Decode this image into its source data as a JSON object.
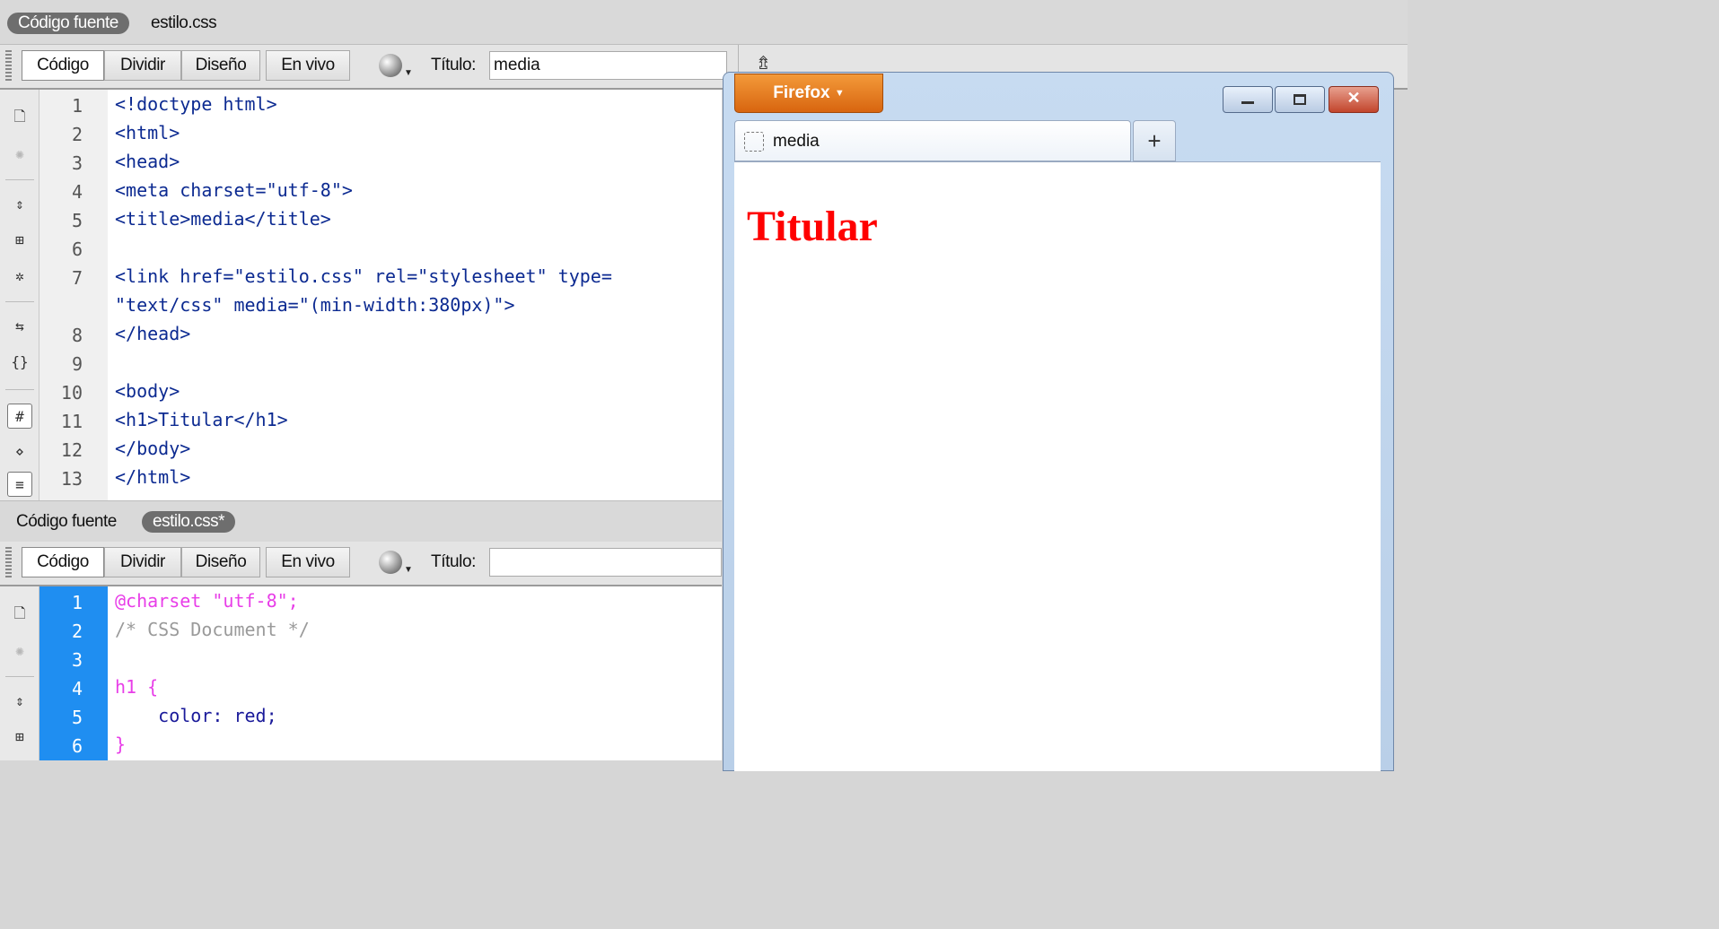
{
  "top_editor": {
    "files": {
      "source": "Código fuente",
      "related": "estilo.css"
    },
    "toolbar": {
      "buttons": [
        "Código",
        "Dividir",
        "Diseño",
        "En vivo"
      ],
      "title_label": "Título:",
      "title_value": "media"
    },
    "line_numbers": [
      "1",
      "2",
      "3",
      "4",
      "5",
      "6",
      "7",
      "",
      "8",
      "9",
      "10",
      "11",
      "12",
      "13"
    ],
    "code_lines": [
      "<!doctype html>",
      "<html>",
      "<head>",
      "<meta charset=\"utf-8\">",
      "<title>media</title>",
      "",
      "<link href=\"estilo.css\" rel=\"stylesheet\" type=",
      "\"text/css\" media=\"(min-width:380px)\">",
      "</head>",
      "",
      "<body>",
      "<h1>Titular</h1>",
      "</body>",
      "</html>"
    ]
  },
  "bottom_editor": {
    "files": {
      "source": "Código fuente",
      "related": "estilo.css*"
    },
    "toolbar": {
      "buttons": [
        "Código",
        "Dividir",
        "Diseño",
        "En vivo"
      ],
      "title_label": "Título:",
      "title_value": ""
    },
    "line_numbers": [
      "1",
      "2",
      "3",
      "4",
      "5",
      "6"
    ],
    "code_lines": [
      "@charset \"utf-8\";",
      "/* CSS Document */",
      "",
      "h1 {",
      "    color: red;",
      "}"
    ]
  },
  "firefox": {
    "menu_label": "Firefox",
    "tab_title": "media",
    "new_tab": "+",
    "page_heading": "Titular",
    "heading_color": "#ff0000"
  },
  "colors": {
    "line_gutter_active": "#1f8ef1",
    "firefox_orange": "#e5781f"
  }
}
